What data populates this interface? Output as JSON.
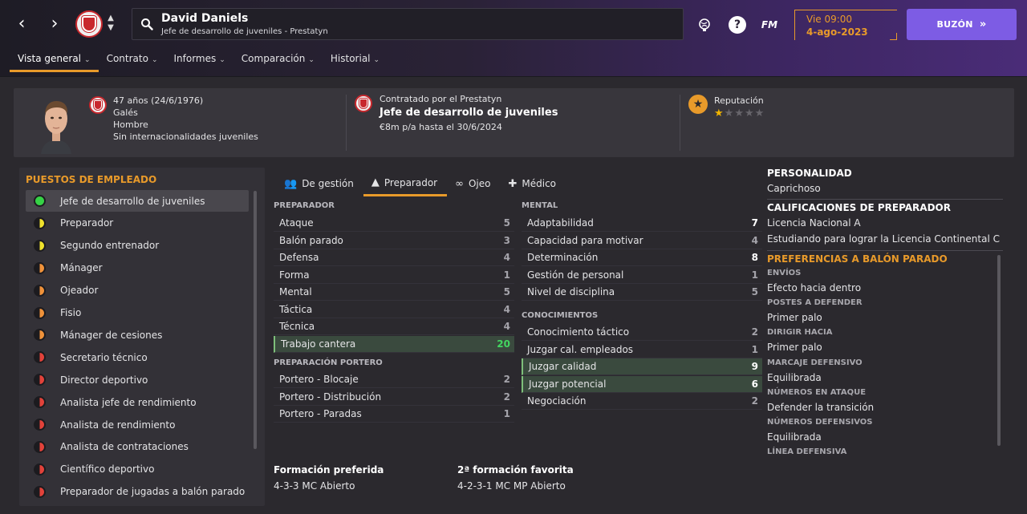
{
  "header": {
    "name": "David Daniels",
    "subtitle": "Jefe de desarrollo de juveniles - Prestatyn",
    "date_day": "Vie 09:00",
    "date_date": "4-ago-2023",
    "inbox_label": "BUZÓN",
    "fm_label": "FM",
    "accent": "#e89a2a",
    "inbox_color": "#7d5ce4"
  },
  "subnav": [
    {
      "label": "Vista general"
    },
    {
      "label": "Contrato"
    },
    {
      "label": "Informes"
    },
    {
      "label": "Comparación"
    },
    {
      "label": "Historial"
    }
  ],
  "profile": {
    "age": "47 años (24/6/1976)",
    "nationality": "Galés",
    "gender": "Hombre",
    "caps": "Sin internacionalidades juveniles",
    "contract_label": "Contratado por el Prestatyn",
    "job": "Jefe de desarrollo de juveniles",
    "wage": "€8m p/a hasta el 30/6/2024",
    "reputation_label": "Reputación",
    "reputation_stars": 1,
    "reputation_max": 5
  },
  "roles_panel": {
    "title": "Puestos de empleado",
    "items": [
      {
        "label": "Jefe de desarrollo de juveniles",
        "status": "full"
      },
      {
        "label": "Preparador",
        "status": "half-yellow"
      },
      {
        "label": "Segundo entrenador",
        "status": "half-yellow"
      },
      {
        "label": "Mánager",
        "status": "half-orange"
      },
      {
        "label": "Ojeador",
        "status": "half-orange"
      },
      {
        "label": "Fisio",
        "status": "half-orange"
      },
      {
        "label": "Mánager de cesiones",
        "status": "half-orange"
      },
      {
        "label": "Secretario técnico",
        "status": "half-red"
      },
      {
        "label": "Director deportivo",
        "status": "half-red"
      },
      {
        "label": "Analista jefe de rendimiento",
        "status": "half-red"
      },
      {
        "label": "Analista de rendimiento",
        "status": "half-red"
      },
      {
        "label": "Analista de contrataciones",
        "status": "half-red"
      },
      {
        "label": "Científico deportivo",
        "status": "half-red"
      },
      {
        "label": "Preparador de jugadas a balón parado",
        "status": "half-red"
      }
    ]
  },
  "tabs": [
    {
      "label": "De gestión",
      "icon": "people-icon"
    },
    {
      "label": "Preparador",
      "icon": "cones-icon"
    },
    {
      "label": "Ojeo",
      "icon": "binoculars-icon"
    },
    {
      "label": "Médico",
      "icon": "medical-kit-icon"
    }
  ],
  "coaching": {
    "head": "Preparador",
    "attrs": [
      {
        "label": "Ataque",
        "value": "5"
      },
      {
        "label": "Balón parado",
        "value": "3"
      },
      {
        "label": "Defensa",
        "value": "4"
      },
      {
        "label": "Forma",
        "value": "1"
      },
      {
        "label": "Mental",
        "value": "5"
      },
      {
        "label": "Táctica",
        "value": "4"
      },
      {
        "label": "Técnica",
        "value": "4"
      },
      {
        "label": "Trabajo cantera",
        "value": "20"
      }
    ]
  },
  "gk": {
    "head": "Preparación portero",
    "attrs": [
      {
        "label": "Portero - Blocaje",
        "value": "2"
      },
      {
        "label": "Portero - Distribución",
        "value": "2"
      },
      {
        "label": "Portero - Paradas",
        "value": "1"
      }
    ]
  },
  "mental": {
    "head": "Mental",
    "attrs": [
      {
        "label": "Adaptabilidad",
        "value": "7"
      },
      {
        "label": "Capacidad para motivar",
        "value": "4"
      },
      {
        "label": "Determinación",
        "value": "8"
      },
      {
        "label": "Gestión de personal",
        "value": "1"
      },
      {
        "label": "Nivel de disciplina",
        "value": "5"
      }
    ]
  },
  "knowledge": {
    "head": "Conocimientos",
    "attrs": [
      {
        "label": "Conocimiento táctico",
        "value": "2"
      },
      {
        "label": "Juzgar cal. empleados",
        "value": "1"
      },
      {
        "label": "Juzgar calidad",
        "value": "9"
      },
      {
        "label": "Juzgar potencial",
        "value": "6"
      },
      {
        "label": "Negociación",
        "value": "2"
      }
    ]
  },
  "formations": {
    "pref_head": "Formación preferida",
    "pref_val": "4-3-3 MC Abierto",
    "second_head": "2ª formación favorita",
    "second_val": "4-2-3-1 MC MP Abierto"
  },
  "right": {
    "personality_head": "Personalidad",
    "personality": "Caprichoso",
    "quals_head": "Calificaciones de preparador",
    "qual1": "Licencia Nacional A",
    "qual2": "Estudiando para lograr la Licencia Continental C",
    "setpiece_head": "Preferencias a balón parado",
    "prefs": [
      {
        "head": "Envíos",
        "value": "Efecto hacia dentro"
      },
      {
        "head": "Postes a defender",
        "value": "Primer palo"
      },
      {
        "head": "Dirigir hacia",
        "value": "Primer palo"
      },
      {
        "head": "Marcaje defensivo",
        "value": "Equilibrada"
      },
      {
        "head": "Números en ataque",
        "value": "Defender la transición"
      },
      {
        "head": "Números defensivos",
        "value": "Equilibrada"
      },
      {
        "head": "Línea defensiva",
        "value": ""
      }
    ]
  }
}
